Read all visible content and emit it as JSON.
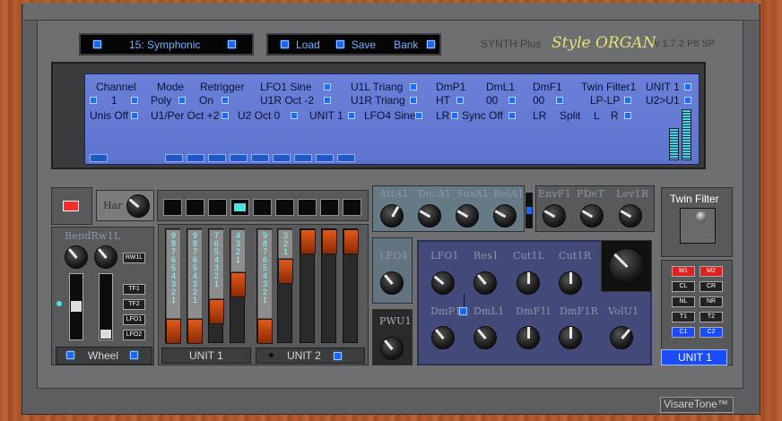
{
  "preset": {
    "name": "15: Symphonic"
  },
  "file": {
    "load": "Load",
    "save": "Save",
    "bank": "Bank"
  },
  "brand": {
    "synth": "SYNTH Plus",
    "style": "Style ORGAN",
    "version": "v 1.7.2 P8 SP"
  },
  "lcd": {
    "row1": [
      "Channel",
      "Mode",
      "Retrigger",
      "LFO1 Sine",
      "U1L Triang",
      "DmP1",
      "DmL1",
      "DmF1",
      "Twin Filter1",
      "UNIT 1"
    ],
    "row2": [
      "1",
      "Poly",
      "On",
      "U1R Oct  -2",
      "U1R Triang",
      "HT",
      "00",
      "00",
      "LP-LP",
      "U2>U1"
    ],
    "row3": [
      "Unis Off",
      "U1/Per Oct +2",
      "U2 Oct  0",
      "UNIT 1",
      "LFO4 Sine",
      "LR",
      "Sync Off",
      "LR",
      "Split",
      "L",
      "R"
    ]
  },
  "har": "Har",
  "bend": "BendRw1L",
  "rw": "RW1L",
  "tf": [
    "TF1",
    "TF2",
    "LFO1",
    "LFO2"
  ],
  "wheel": "Wheel",
  "unit1": "UNIT 1",
  "unit2": "UNIT 2",
  "drawbars": [
    "987654321",
    "987654321",
    "7654321",
    "4321",
    "987654321",
    "321"
  ],
  "envtop": [
    "AttA1",
    "DecA1",
    "SusA1",
    "RelA1"
  ],
  "envtop2": [
    "EnvF1",
    "PDeT",
    "Lev1R"
  ],
  "lfo4": "LFO4",
  "pwu1": "PWU1",
  "filter": {
    "row1": [
      "LFO1",
      "Res1",
      "Cut1L",
      "Cut1R"
    ],
    "row2": [
      "DmP1",
      "DmL1",
      "DmF1l",
      "DmF1R",
      "VolU1"
    ]
  },
  "twin": {
    "title": "Twin Filter",
    "unit": "UNIT 1"
  },
  "mbtns": [
    "M1",
    "M2",
    "CL",
    "CR",
    "NL",
    "NR",
    "T1",
    "T2",
    "C1",
    "C2"
  ],
  "footer": "VisareTone™",
  "colors": {
    "accent": "#1a66ff",
    "lcd": "#6a80d8",
    "wood": "#b05a2e"
  }
}
